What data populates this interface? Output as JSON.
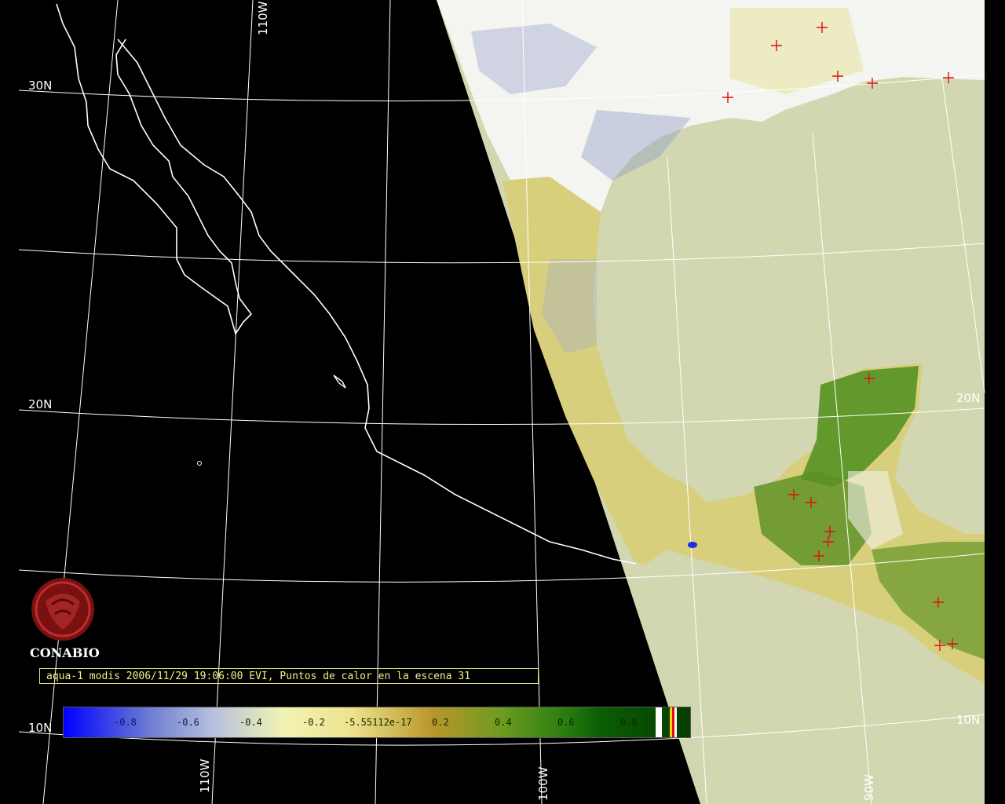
{
  "map": {
    "grid_labels": {
      "lat_30": "30N",
      "lat_20_left": "20N",
      "lat_20_right": "20N",
      "lat_10_left": "10N",
      "lat_10_right": "10N",
      "lon_110_top": "110W",
      "lon_110_bottom": "110W",
      "lon_100_bottom": "100W",
      "lon_90_bottom": "90W"
    }
  },
  "logo": {
    "title": "CONABIO"
  },
  "caption": "aqua-1 modis 2006/11/29 19:06:00 EVI, Puntos de calor en la escena 31",
  "colorbar": {
    "ticks": [
      "-0.8",
      "-0.6",
      "-0.4",
      "-0.2",
      "-5.55112e-17",
      "0.2",
      "0.4",
      "0.6",
      "0.8"
    ]
  },
  "colors": {
    "ocean": "#d2d6b0",
    "night": "#000000",
    "hotspot": "#e01010",
    "caption_text": "#f2f08a"
  }
}
